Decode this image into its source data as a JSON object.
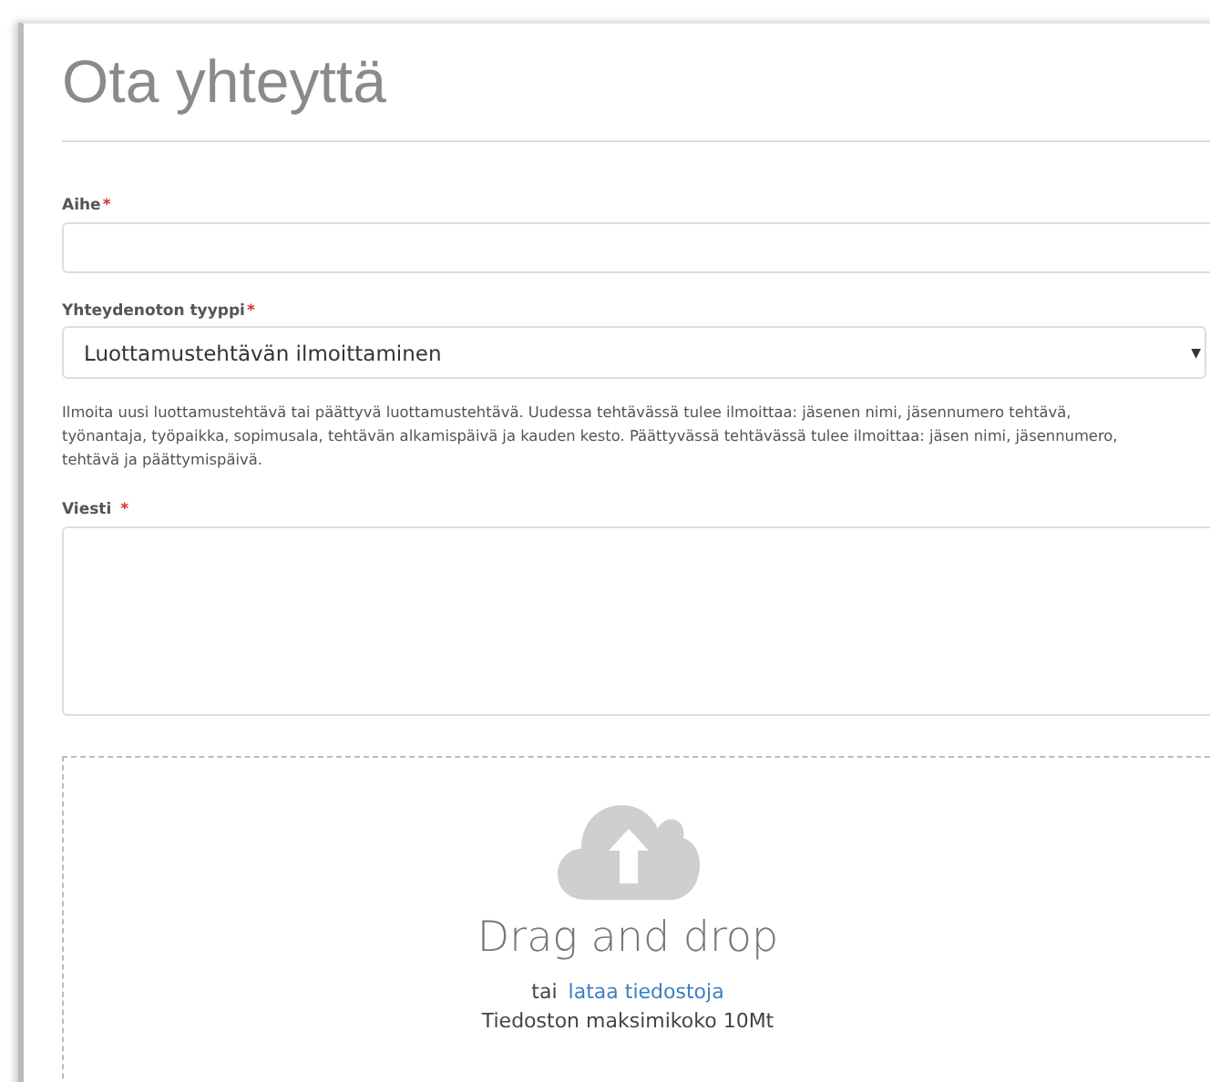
{
  "title": "Ota yhteyttä",
  "fields": [
    {
      "kind": "input",
      "label": "Aihe",
      "marker": "*"
    },
    {
      "kind": "select",
      "label": "Yhteydenoton tyyppi",
      "marker": "*",
      "value": "Luottamustehtävän ilmoittaminen",
      "caret": "▼",
      "help": "Ilmoita uusi luottamustehtävä tai päättyvä luottamustehtävä. Uudessa tehtävässä tulee ilmoittaa: jäsenen nimi, jäsennumero tehtävä, työnantaja, työpaikka, sopimusala, tehtävän alkamispäivä ja kauden kesto. Päättyvässä tehtävässä tulee ilmoittaa: jäsen nimi, jäsennumero, tehtävä ja päättymispäivä."
    },
    {
      "kind": "textarea",
      "label": "Viesti",
      "marker": "*"
    }
  ],
  "dropzone": {
    "heading": "Drag and drop",
    "or": "tai",
    "link": "lataa tiedostoja",
    "limit": "Tiedoston maksimikoko 10Mt"
  }
}
